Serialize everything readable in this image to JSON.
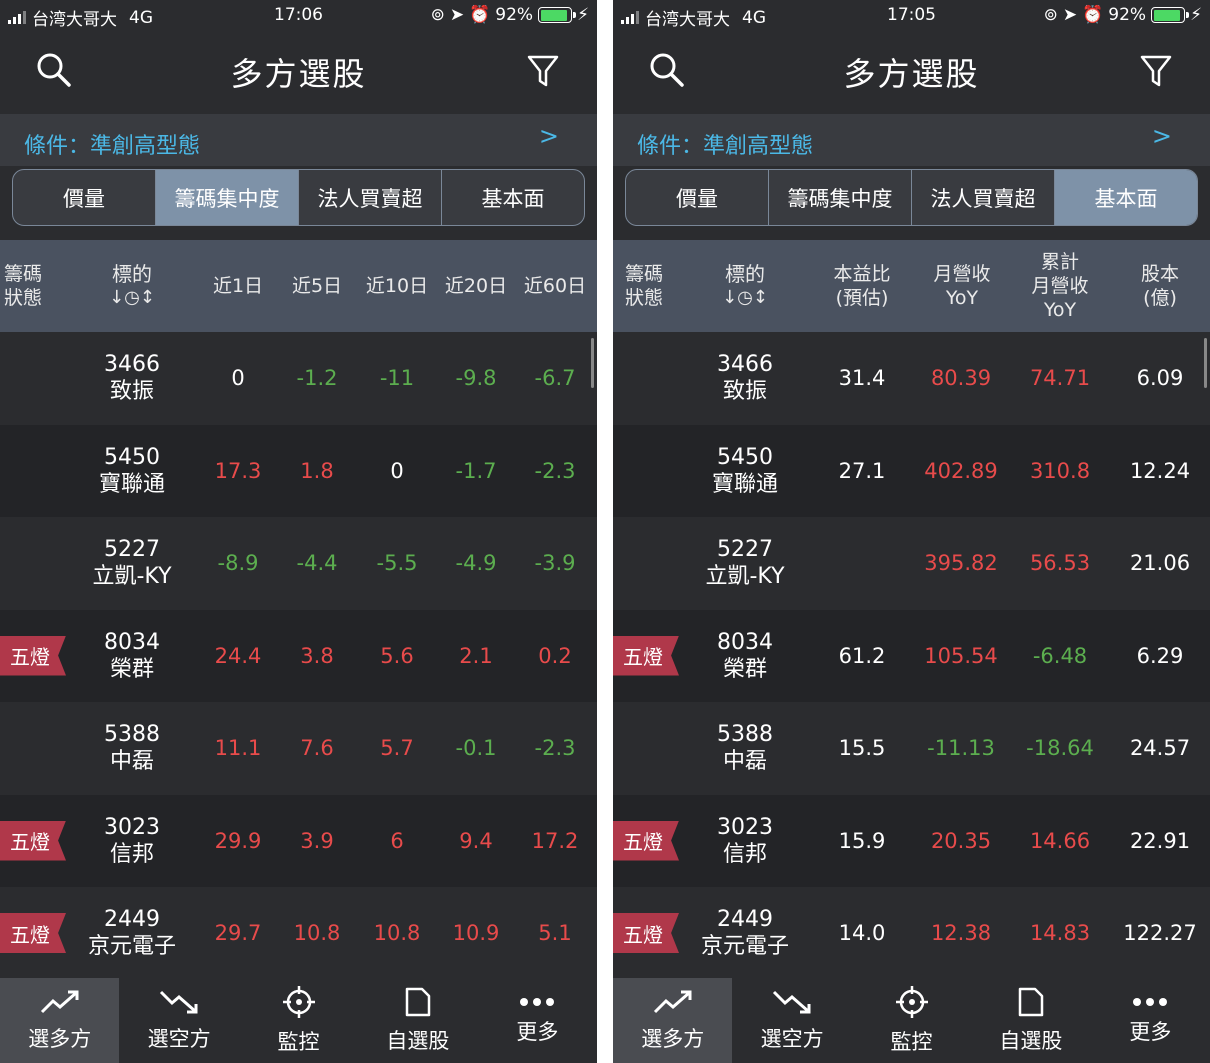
{
  "left": {
    "status": {
      "carrier": "台湾大哥大",
      "network": "4G",
      "time": "17:06",
      "battery": "92%"
    },
    "title": "多方選股",
    "condition": "條件：準創高型態",
    "condition_arrow": ">",
    "segments": [
      "價量",
      "籌碼集中度",
      "法人買賣超",
      "基本面"
    ],
    "active_segment": 1,
    "headers": {
      "status": [
        "籌碼",
        "狀態"
      ],
      "symbol": "標的",
      "sort_icon": "↓◷↕",
      "cols": [
        [
          "近1日"
        ],
        [
          "近5日"
        ],
        [
          "近10日"
        ],
        [
          "近20日"
        ],
        [
          "近60日"
        ]
      ]
    },
    "rows": [
      {
        "tag": "",
        "code": "3466",
        "name": "致振",
        "vals": [
          "0",
          "-1.2",
          "-11",
          "-9.8",
          "-6.7"
        ]
      },
      {
        "tag": "",
        "code": "5450",
        "name": "寶聯通",
        "vals": [
          "17.3",
          "1.8",
          "0",
          "-1.7",
          "-2.3"
        ]
      },
      {
        "tag": "",
        "code": "5227",
        "name": "立凱-KY",
        "vals": [
          "-8.9",
          "-4.4",
          "-5.5",
          "-4.9",
          "-3.9"
        ]
      },
      {
        "tag": "五燈",
        "code": "8034",
        "name": "榮群",
        "vals": [
          "24.4",
          "3.8",
          "5.6",
          "2.1",
          "0.2"
        ]
      },
      {
        "tag": "",
        "code": "5388",
        "name": "中磊",
        "vals": [
          "11.1",
          "7.6",
          "5.7",
          "-0.1",
          "-2.3"
        ]
      },
      {
        "tag": "五燈",
        "code": "3023",
        "name": "信邦",
        "vals": [
          "29.9",
          "3.9",
          "6",
          "9.4",
          "17.2"
        ]
      },
      {
        "tag": "五燈",
        "code": "2449",
        "name": "京元電子",
        "vals": [
          "29.7",
          "10.8",
          "10.8",
          "10.9",
          "5.1"
        ]
      }
    ],
    "tabs": [
      "選多方",
      "選空方",
      "監控",
      "自選股",
      "更多"
    ],
    "active_tab": 0
  },
  "right": {
    "status": {
      "carrier": "台湾大哥大",
      "network": "4G",
      "time": "17:05",
      "battery": "92%"
    },
    "title": "多方選股",
    "condition": "條件：準創高型態",
    "condition_arrow": ">",
    "segments": [
      "價量",
      "籌碼集中度",
      "法人買賣超",
      "基本面"
    ],
    "active_segment": 3,
    "headers": {
      "status": [
        "籌碼",
        "狀態"
      ],
      "symbol": "標的",
      "sort_icon": "↓◷↕",
      "cols": [
        [
          "本益比",
          "(預估)"
        ],
        [
          "月營收",
          "YoY"
        ],
        [
          "累計",
          "月營收",
          "YoY"
        ],
        [
          "股本",
          "(億)"
        ]
      ]
    },
    "rows": [
      {
        "tag": "",
        "code": "3466",
        "name": "致振",
        "vals": [
          "31.4",
          "80.39",
          "74.71",
          "6.09"
        ]
      },
      {
        "tag": "",
        "code": "5450",
        "name": "寶聯通",
        "vals": [
          "27.1",
          "402.89",
          "310.8",
          "12.24"
        ]
      },
      {
        "tag": "",
        "code": "5227",
        "name": "立凱-KY",
        "vals": [
          "",
          "395.82",
          "56.53",
          "21.06"
        ]
      },
      {
        "tag": "五燈",
        "code": "8034",
        "name": "榮群",
        "vals": [
          "61.2",
          "105.54",
          "-6.48",
          "6.29"
        ]
      },
      {
        "tag": "",
        "code": "5388",
        "name": "中磊",
        "vals": [
          "15.5",
          "-11.13",
          "-18.64",
          "24.57"
        ]
      },
      {
        "tag": "五燈",
        "code": "3023",
        "name": "信邦",
        "vals": [
          "15.9",
          "20.35",
          "14.66",
          "22.91"
        ]
      },
      {
        "tag": "五燈",
        "code": "2449",
        "name": "京元電子",
        "vals": [
          "14.0",
          "12.38",
          "14.83",
          "122.27"
        ]
      }
    ],
    "tabs": [
      "選多方",
      "選空方",
      "監控",
      "自選股",
      "更多"
    ],
    "active_tab": 0
  },
  "colors": {
    "positive": "#e84b4b",
    "negative": "#5cae4f",
    "accent": "#4bb8e6",
    "tag": "#b0384a",
    "active_segment": "#7e92a8"
  },
  "icons": {
    "search": "search-icon",
    "filter": "filter-icon",
    "tabs": [
      "trend-up-icon",
      "trend-down-icon",
      "crosshair-icon",
      "document-icon",
      "more-icon"
    ]
  }
}
